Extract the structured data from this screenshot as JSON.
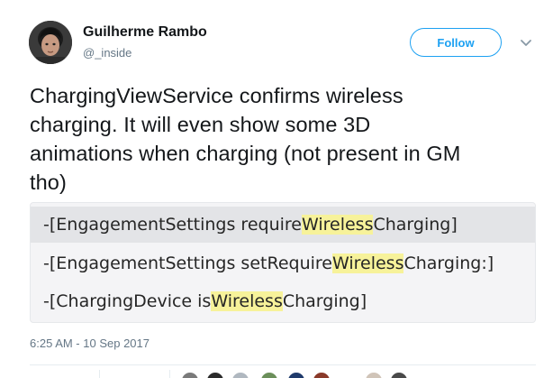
{
  "user": {
    "display_name": "Guilherme Rambo",
    "handle": "@_inside"
  },
  "follow_button": {
    "label": "Follow"
  },
  "tweet": {
    "lines": [
      "ChargingViewService confirms wireless",
      "charging. It will even show some 3D",
      "animations when charging (not present in GM",
      "tho)"
    ]
  },
  "media": {
    "code_lines": [
      {
        "prefix": "-[EngagementSettings require",
        "highlight": "Wireless",
        "suffix": "Charging]"
      },
      {
        "prefix": "-[EngagementSettings setRequire",
        "highlight": "Wireless",
        "suffix": "Charging:]"
      },
      {
        "prefix": "-[ChargingDevice is",
        "highlight": "Wireless",
        "suffix": "Charging]"
      }
    ]
  },
  "timestamp": "6:25 AM - 10 Sep 2017",
  "icons": {
    "avatar": "profile-avatar",
    "menu": "chevron-down-icon"
  },
  "colors": {
    "accent": "#1da1f2",
    "highlight": "#f7f29a",
    "secondary_text": "#657786"
  }
}
